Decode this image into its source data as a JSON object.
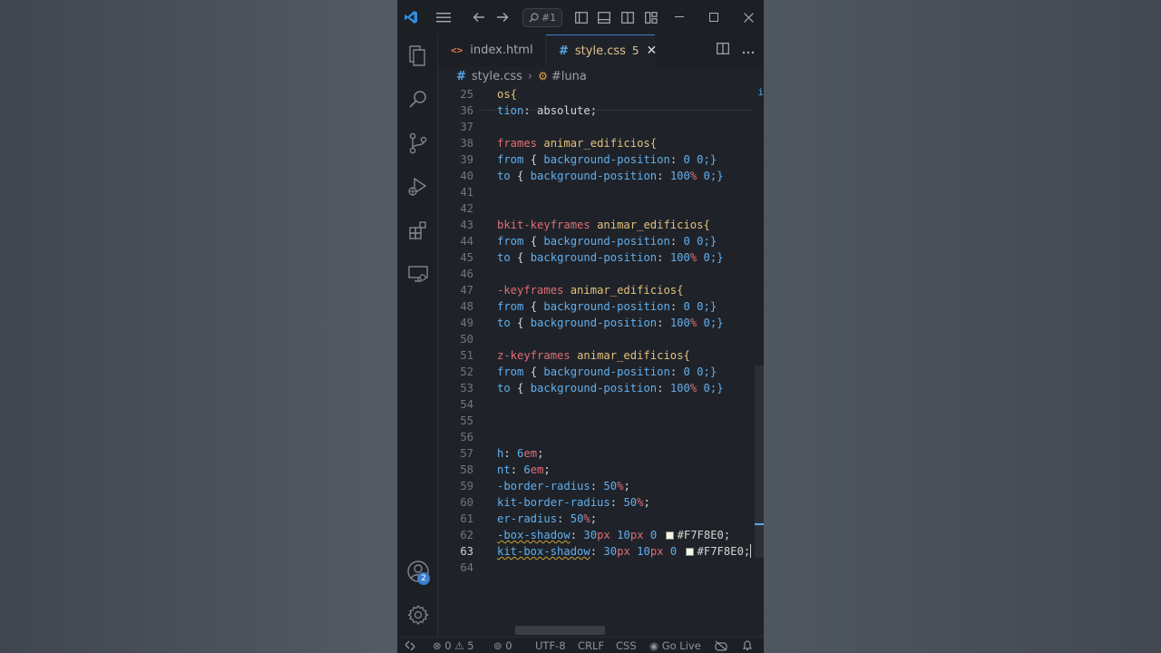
{
  "titlebar": {
    "search_label": "#1",
    "icons": [
      "vscode-logo",
      "menu-icon",
      "back-arrow-icon",
      "forward-arrow-icon",
      "search-icon",
      "toggle-sidebar-icon",
      "toggle-panel-icon",
      "toggle-secondary-sidebar-icon",
      "customize-layout-icon",
      "minimize-icon",
      "maximize-icon",
      "close-icon"
    ]
  },
  "activity": {
    "icons": [
      "explorer-icon",
      "search-icon",
      "source-control-icon",
      "run-debug-icon",
      "extensions-icon",
      "remote-explorer-icon",
      "accounts-icon",
      "settings-gear-icon"
    ],
    "accounts_badge": "2"
  },
  "tabs": [
    {
      "icon": "<>",
      "label": "index.html"
    },
    {
      "icon": "#",
      "label": "style.css",
      "count": "5",
      "close": "✕"
    }
  ],
  "breadcrumb": {
    "file": "style.css",
    "symbol": "#luna"
  },
  "gutter": [
    "25",
    "36",
    "37",
    "38",
    "39",
    "40",
    "41",
    "42",
    "43",
    "44",
    "45",
    "46",
    "47",
    "48",
    "49",
    "50",
    "51",
    "52",
    "53",
    "54",
    "55",
    "56",
    "57",
    "58",
    "59",
    "60",
    "61",
    "62",
    "63",
    "64"
  ],
  "code": {
    "l25": "os{",
    "l36a": "tion",
    "l36b": ": absolute;",
    "l38a": "frames",
    "l38b": "animar_edificios{",
    "from": "from",
    "to": "to",
    "bgpos": "background-position",
    "v00": "0 0;}",
    "v100a": "100",
    "pct": "%",
    "v100b": "0;}",
    "brace": "{",
    "l43a": "bkit-keyframes",
    "l43b": "animar_edificios{",
    "l47a": "-keyframes",
    "l47b": "animar_edificios{",
    "l51a": "z-keyframes",
    "l51b": "animar_edificios{",
    "l57a": "h",
    "l57b": "6",
    "l57c": "em",
    "l57d": ";",
    "l58a": "nt",
    "l58b": "6",
    "l58c": "em",
    "l58d": ";",
    "l59a": "-border-radius",
    "l59b": "50",
    "l59c": "%",
    "l59d": ";",
    "l60a": "kit-border-radius",
    "l60b": "50",
    "l60c": "%",
    "l60d": ";",
    "l61a": "er-radius",
    "l61b": "50",
    "l61c": "%",
    "l61d": ";",
    "l62a": "-box-shadow",
    "l62b": "30",
    "l62c": "px",
    "l62d": "10",
    "l62e": "px",
    "l62f": "0",
    "l62g": "#F7F8E0;",
    "l63a": "kit-box-shadow",
    "l63b": "30",
    "l63c": "px",
    "l63d": "10",
    "l63e": "px",
    "l63f": "0",
    "l63g": "#F7F8E0;",
    "colon": ":"
  },
  "right_marker": "i",
  "status": {
    "errors": "0",
    "warnings": "5",
    "ports": "0",
    "encoding": "UTF-8",
    "eol": "CRLF",
    "language": "CSS",
    "golive": "Go Live"
  },
  "colors": {
    "accent": "#3b7fd1",
    "background": "#1f2329",
    "swatch": "#F7F8E0"
  }
}
